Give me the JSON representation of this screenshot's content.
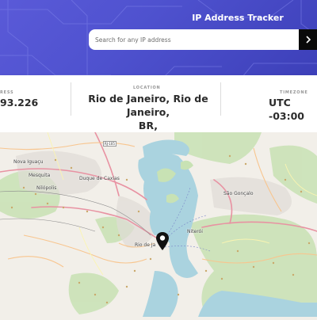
{
  "header": {
    "title": "IP Address Tracker",
    "search": {
      "placeholder": "Search for any IP address",
      "value": ""
    },
    "submit_icon": "chevron-right-icon",
    "background_color": "#5054d0"
  },
  "info": {
    "ip_address": {
      "label": "RESS",
      "value": "93.226"
    },
    "location": {
      "label": "LOCATION",
      "value_line1": "Rio de Janeiro, Rio de Janeiro,",
      "value_line2": "BR,"
    },
    "timezone": {
      "label": "TIMEZONE",
      "value": "UTC -03:00"
    }
  },
  "map": {
    "labels": {
      "nova_iguacu": "Nova Iguaçu",
      "mesquita": "Mesquita",
      "nilopolis": "Nilópolis",
      "duque_de_caxias": "Duque de Caxias",
      "sao_goncalo": "São Gonçalo",
      "niteroi": "Niterói",
      "rio_de_janeiro": "Rio de Ja"
    },
    "road_badge": "RJ-105",
    "marker_icon": "map-pin-icon",
    "water_color": "#aad3df",
    "land_color": "#f2efe9"
  }
}
